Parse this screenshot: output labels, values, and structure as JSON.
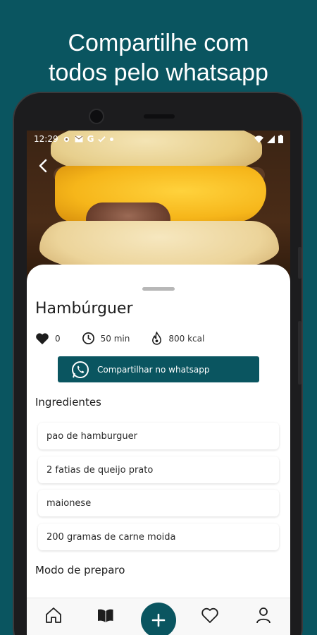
{
  "promo": {
    "line1": "Compartilhe com",
    "line2": "todos pelo whatsapp"
  },
  "status_bar": {
    "time": "12:29",
    "left_icons": [
      "gear-icon",
      "mail-icon",
      "google-icon",
      "check-icon",
      "dot-icon"
    ],
    "right_icons": [
      "wifi-icon",
      "signal-icon",
      "battery-icon"
    ]
  },
  "recipe": {
    "title": "Hambúrguer",
    "likes": "0",
    "time": "50 min",
    "calories": "800 kcal",
    "share_label": "Compartilhar no whatsapp"
  },
  "ingredients": {
    "title": "Ingredientes",
    "items": [
      "pao de hamburguer",
      "2 fatias de queijo prato",
      "maionese",
      "200 gramas de carne moida"
    ]
  },
  "preparation": {
    "title": "Modo de preparo"
  },
  "bottom_nav": {
    "items": [
      "home-icon",
      "book-icon",
      "add-icon",
      "heart-icon",
      "profile-icon"
    ]
  },
  "colors": {
    "brand": "#0a5560",
    "text": "#1d1d1d",
    "cheese": "#f6b61a"
  }
}
